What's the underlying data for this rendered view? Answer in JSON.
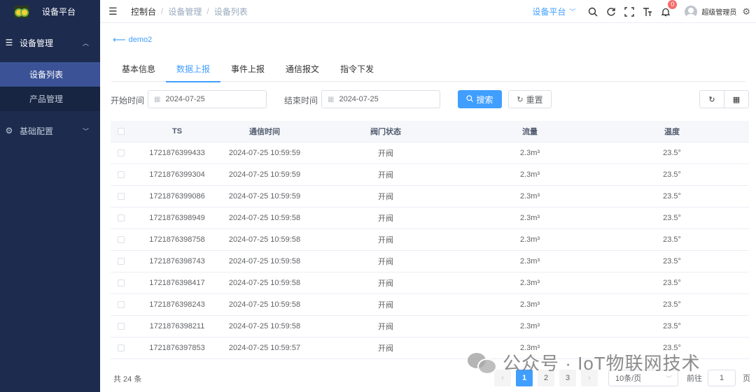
{
  "brand": {
    "title": "设备平台"
  },
  "sidebar": {
    "groups": [
      {
        "label": "设备管理",
        "items": [
          {
            "label": "设备列表"
          },
          {
            "label": "产品管理"
          }
        ]
      },
      {
        "label": "基础配置"
      }
    ]
  },
  "header": {
    "breadcrumb": [
      "控制台",
      "设备管理",
      "设备列表"
    ],
    "platform": "设备平台",
    "notification_count": "0",
    "username": "超级管理员"
  },
  "main": {
    "back_label": "demo2",
    "tabs": [
      "基本信息",
      "数据上报",
      "事件上报",
      "通信报文",
      "指令下发"
    ],
    "active_tab": "数据上报",
    "filters": {
      "start_label": "开始时间",
      "start_value": "2024-07-25",
      "end_label": "结束时间",
      "end_value": "2024-07-25",
      "search_label": "搜索",
      "reset_label": "重置"
    },
    "table": {
      "columns": [
        "TS",
        "通信时间",
        "阀门状态",
        "流量",
        "温度"
      ],
      "rows": [
        [
          "1721876399433",
          "2024-07-25 10:59:59",
          "开阀",
          "2.3m³",
          "23.5°"
        ],
        [
          "1721876399304",
          "2024-07-25 10:59:59",
          "开阀",
          "2.3m³",
          "23.5°"
        ],
        [
          "1721876399086",
          "2024-07-25 10:59:59",
          "开阀",
          "2.3m³",
          "23.5°"
        ],
        [
          "1721876398949",
          "2024-07-25 10:59:58",
          "开阀",
          "2.3m³",
          "23.5°"
        ],
        [
          "1721876398758",
          "2024-07-25 10:59:58",
          "开阀",
          "2.3m³",
          "23.5°"
        ],
        [
          "1721876398743",
          "2024-07-25 10:59:58",
          "开阀",
          "2.3m³",
          "23.5°"
        ],
        [
          "1721876398417",
          "2024-07-25 10:59:58",
          "开阀",
          "2.3m³",
          "23.5°"
        ],
        [
          "1721876398243",
          "2024-07-25 10:59:58",
          "开阀",
          "2.3m³",
          "23.5°"
        ],
        [
          "1721876398211",
          "2024-07-25 10:59:58",
          "开阀",
          "2.3m³",
          "23.5°"
        ],
        [
          "1721876397853",
          "2024-07-25 10:59:57",
          "开阀",
          "2.3m³",
          "23.5°"
        ]
      ]
    },
    "pagination": {
      "total_text": "共 24 条",
      "pages": [
        "1",
        "2",
        "3"
      ],
      "current_page": "1",
      "page_size": "10条/页",
      "goto_label": "前往",
      "goto_value": "1",
      "page_unit": "页"
    }
  },
  "watermark": {
    "text": "公众号 · IoT物联网技术"
  },
  "colors": {
    "sidebar_bg": "#1d2b4f",
    "accent": "#409eff",
    "active_menu": "#3b5396",
    "badge": "#f56c6c"
  }
}
